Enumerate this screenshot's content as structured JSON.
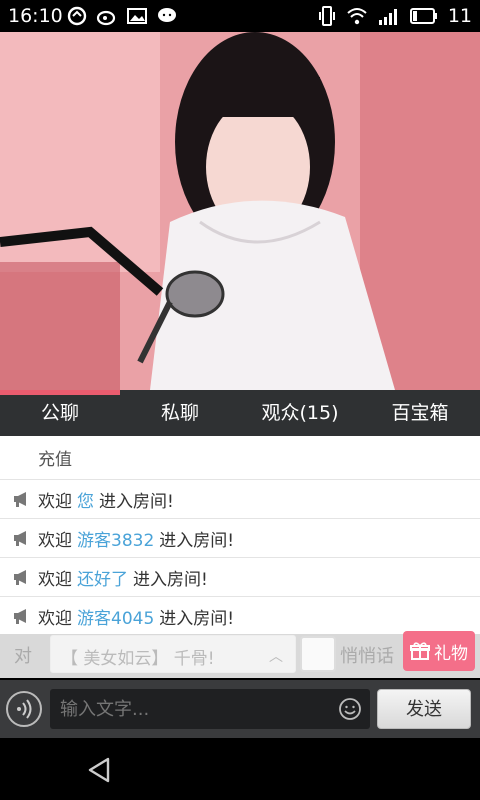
{
  "status_bar": {
    "time": "16:10",
    "battery_level": "11",
    "icons": [
      "sync-icon",
      "weibo-icon",
      "image-icon",
      "wechat-icon",
      "vibrate-icon",
      "wifi-icon",
      "signal-icon",
      "battery-icon"
    ]
  },
  "video": {
    "description_icon": "live-video"
  },
  "tabs": [
    {
      "label": "公聊",
      "active": true
    },
    {
      "label": "私聊",
      "active": false
    },
    {
      "label": "观众(15)",
      "active": false
    },
    {
      "label": "百宝箱",
      "active": false
    }
  ],
  "chat": {
    "recharge_label": "充值",
    "messages": [
      {
        "prefix": "欢迎",
        "name": "您",
        "suffix": "进入房间!"
      },
      {
        "prefix": "欢迎",
        "name": "游客3832",
        "suffix": "进入房间!"
      },
      {
        "prefix": "欢迎",
        "name": "还好了",
        "suffix": "进入房间!"
      },
      {
        "prefix": "欢迎",
        "name": "游客4045",
        "suffix": "进入房间!"
      }
    ]
  },
  "options": {
    "to_label": "对",
    "target": "【 美女如云】 千骨!",
    "whisper_label": "悄悄话",
    "gift_label": "礼物"
  },
  "input": {
    "placeholder": "输入文字...",
    "send_label": "发送"
  },
  "colors": {
    "accent": "#ea5c6f",
    "name_link": "#4aa3d8",
    "gift_button": "#f46f89"
  }
}
